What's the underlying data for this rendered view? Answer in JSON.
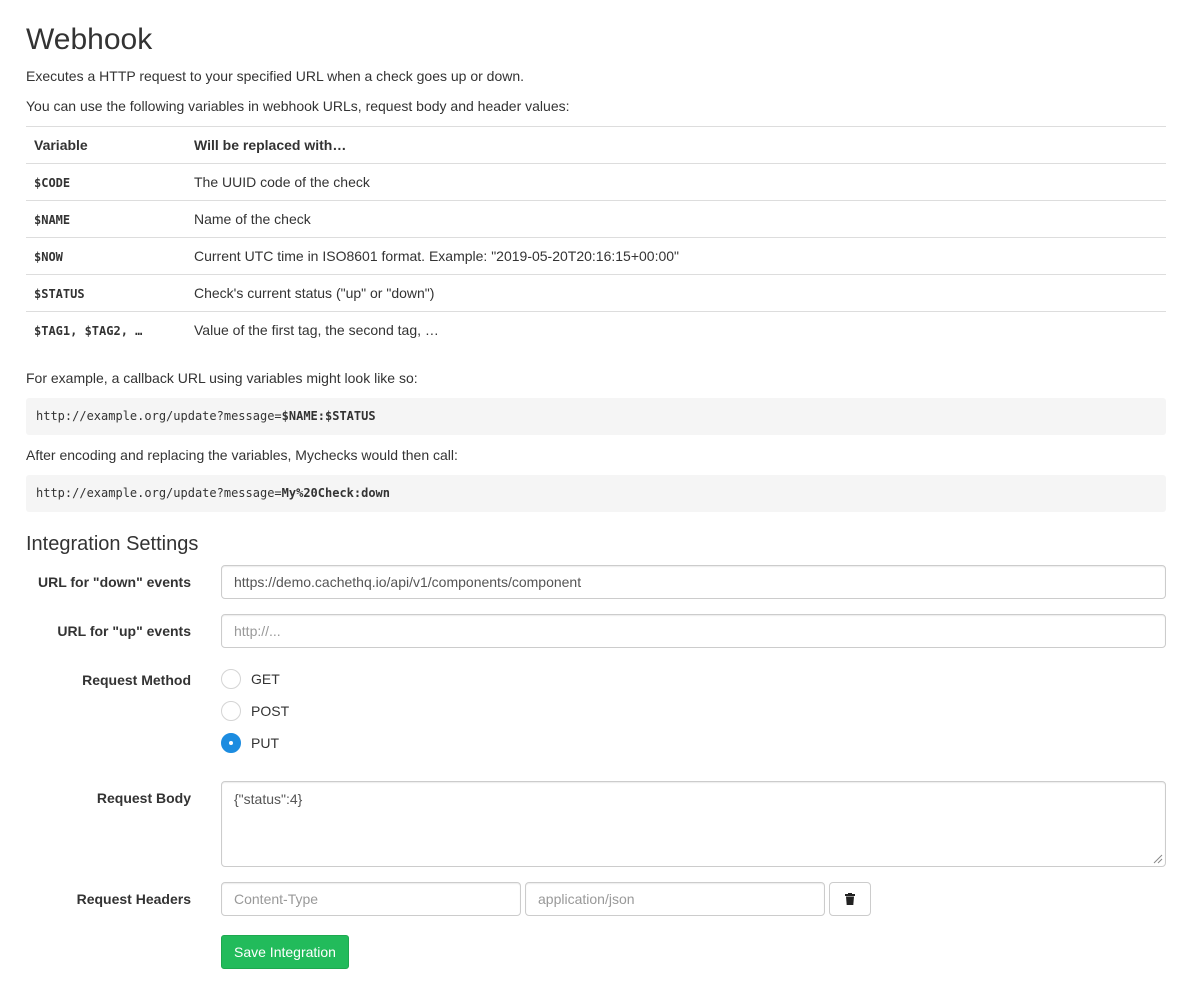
{
  "page": {
    "title": "Webhook",
    "intro": "Executes a HTTP request to your specified URL when a check goes up or down.",
    "variables_intro": "You can use the following variables in webhook URLs, request body and header values:"
  },
  "variables_table": {
    "headers": [
      "Variable",
      "Will be replaced with…"
    ],
    "rows": [
      {
        "variable": "$CODE",
        "description": "The UUID code of the check"
      },
      {
        "variable": "$NAME",
        "description": "Name of the check"
      },
      {
        "variable": "$NOW",
        "description": "Current UTC time in ISO8601 format. Example: \"2019-05-20T20:16:15+00:00\""
      },
      {
        "variable": "$STATUS",
        "description": "Check's current status (\"up\" or \"down\")"
      },
      {
        "variable": "$TAG1, $TAG2, …",
        "description": "Value of the first tag, the second tag, …"
      }
    ]
  },
  "example": {
    "intro": "For example, a callback URL using variables might look like so:",
    "url_prefix": "http://example.org/update?message=",
    "url_vars": "$NAME:$STATUS",
    "after_text": "After encoding and replacing the variables, Mychecks would then call:",
    "result_prefix": "http://example.org/update?message=",
    "result_vars": "My%20Check:down"
  },
  "settings": {
    "heading": "Integration Settings",
    "url_down": {
      "label": "URL for \"down\" events",
      "value": "https://demo.cachethq.io/api/v1/components/component",
      "placeholder": "http://..."
    },
    "url_up": {
      "label": "URL for \"up\" events",
      "value": "",
      "placeholder": "http://..."
    },
    "method": {
      "label": "Request Method",
      "options": [
        "GET",
        "POST",
        "PUT"
      ],
      "selected": "PUT"
    },
    "body": {
      "label": "Request Body",
      "value": "{\"status\":4}"
    },
    "headers": {
      "label": "Request Headers",
      "name_placeholder": "Content-Type",
      "value_placeholder": "application/json",
      "delete_icon": "trash-icon"
    },
    "save_label": "Save Integration"
  },
  "colors": {
    "accent_blue": "#1c8ce0",
    "save_green": "#22bb5b",
    "code_bg": "#f5f5f5"
  }
}
